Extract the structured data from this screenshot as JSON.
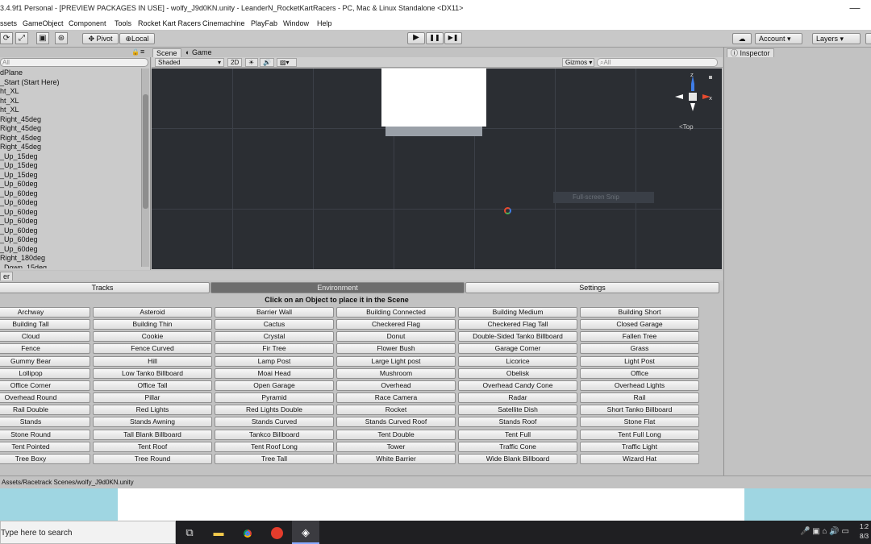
{
  "window": {
    "title": "3.4.9f1 Personal - [PREVIEW PACKAGES IN USE] - wolfy_J9d0KN.unity - LeanderN_RocketKartRacers - PC, Mac & Linux Standalone <DX11>",
    "minimize_glyph": "—"
  },
  "menu": [
    "ssets",
    "GameObject",
    "Component",
    "Tools",
    "Rocket Kart Racers",
    "Cinemachine",
    "PlayFab",
    "Window",
    "Help"
  ],
  "toolbar": {
    "pivot_label": "Pivot",
    "local_label": "Local",
    "play_glyph": "▶",
    "pause_glyph": "❚❚",
    "step_glyph": "▶❚",
    "cloud_glyph": "☁",
    "account_label": "Account",
    "layers_label": "Layers"
  },
  "hierarchy": {
    "search_placeholder": "All",
    "items": [
      "dPlane",
      "_Start (Start Here)",
      "ht_XL",
      "ht_XL",
      "ht_XL",
      "Right_45deg",
      "Right_45deg",
      "Right_45deg",
      "Right_45deg",
      "_Up_15deg",
      "_Up_15deg",
      "_Up_15deg",
      "_Up_60deg",
      "_Up_60deg",
      "_Up_60deg",
      "_Up_60deg",
      "_Up_60deg",
      "_Up_60deg",
      "_Up_60deg",
      "_Up_60deg",
      "Right_180deg",
      "_Down_15deg"
    ]
  },
  "scene": {
    "tab_scene": "Scene",
    "tab_game": "Game",
    "shading_mode": "Shaded",
    "mode_2d": "2D",
    "gizmos_label": "Gizmos",
    "search_placeholder": "All",
    "gizmo_view_label": "Top",
    "tooltip": "Full-screen Snip"
  },
  "inspector": {
    "tab_label": "Inspector"
  },
  "tool_panel": {
    "header_label": "er",
    "tabs": [
      {
        "label": "Tracks",
        "selected": false
      },
      {
        "label": "Environment",
        "selected": true
      },
      {
        "label": "Settings",
        "selected": false
      }
    ],
    "hint": "Click on an Object to place it in the Scene",
    "objects": [
      [
        "Archway",
        "Asteroid",
        "Barrier Wall",
        "Building Connected",
        "Building Medium",
        "Building Short"
      ],
      [
        "Building Tall",
        "Building Thin",
        "Cactus",
        "Checkered Flag",
        "Checkered Flag Tall",
        "Closed Garage"
      ],
      [
        "Cloud",
        "Cookie",
        "Crystal",
        "Donut",
        "Double-Sided Tanko Billboard",
        "Fallen Tree"
      ],
      [
        "Fence",
        "Fence Curved",
        "Fir Tree",
        "Flower Bush",
        "Garage Corner",
        "Grass"
      ],
      [
        "Gummy Bear",
        "Hill",
        "Lamp Post",
        "Large Light post",
        "Licorice",
        "Light Post"
      ],
      [
        "Lollipop",
        "Low Tanko Billboard",
        "Moai Head",
        "Mushroom",
        "Obelisk",
        "Office"
      ],
      [
        "Office Corner",
        "Office Tall",
        "Open Garage",
        "Overhead",
        "Overhead Candy Cone",
        "Overhead Lights"
      ],
      [
        "Overhead Round",
        "Pillar",
        "Pyramid",
        "Race Camera",
        "Radar",
        "Rail"
      ],
      [
        "Rail Double",
        "Red Lights",
        "Red Lights Double",
        "Rocket",
        "Satellite Dish",
        "Short Tanko Billboard"
      ],
      [
        "Stands",
        "Stands Awning",
        "Stands Curved",
        "Stands Curved Roof",
        "Stands Roof",
        "Stone Flat"
      ],
      [
        "Stone Round",
        "Tall Blank Billboard",
        "Tankco Billboard",
        "Tent Double",
        "Tent Full",
        "Tent Full Long"
      ],
      [
        "Tent Pointed",
        "Tent Roof",
        "Tent Roof Long",
        "Tower",
        "Traffic Cone",
        "Traffic Light"
      ],
      [
        "Tree Boxy",
        "Tree Round",
        "Tree Tall",
        "White Barrier",
        "Wide Blank Billboard",
        "Wizard Hat"
      ]
    ]
  },
  "status": {
    "path": "Assets/Racetrack Scenes/wolfy_J9d0KN.unity"
  },
  "taskbar": {
    "search_placeholder": "Type here to search",
    "clock_time": "1:2",
    "clock_date": "8/3"
  }
}
